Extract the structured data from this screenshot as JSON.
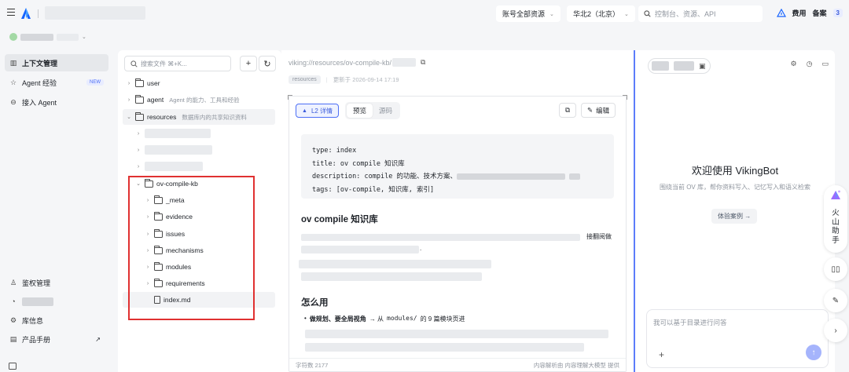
{
  "topbar": {
    "account_scope": "账号全部资源",
    "region": "华北2（北京）",
    "search_placeholder": "控制台、资源、API",
    "fees": "费用",
    "filing": "备案",
    "notification_count": "3"
  },
  "sidebar": {
    "nav": [
      {
        "label": "上下文管理",
        "icon": "book-icon"
      },
      {
        "label": "Agent 经验",
        "icon": "star-icon",
        "badge": "NEW"
      },
      {
        "label": "接入 Agent",
        "icon": "link-icon"
      }
    ],
    "bottom": [
      {
        "label": "鉴权管理",
        "icon": "user-icon"
      },
      {
        "label": "",
        "icon": "chart-icon"
      },
      {
        "label": "库信息",
        "icon": "gear-icon"
      },
      {
        "label": "产品手册",
        "icon": "doc-icon",
        "arrow": "↗"
      }
    ]
  },
  "tree": {
    "search_placeholder": "搜索文件 ⌘+K...",
    "add_label": "+",
    "refresh_label": "↻",
    "items": [
      {
        "name": "user",
        "desc": ""
      },
      {
        "name": "agent",
        "desc": "Agent 的能力、工具和经验"
      },
      {
        "name": "resources",
        "desc": "数据库内的共享知识资料"
      }
    ],
    "kb": {
      "name": "ov-compile-kb",
      "children": [
        "_meta",
        "evidence",
        "issues",
        "mechanisms",
        "modules",
        "requirements"
      ],
      "file": "index.md"
    }
  },
  "doc": {
    "path": "viking://resources/ov-compile-kb/",
    "tag": "resources",
    "updated": "更新于 2026-09-14 17:19",
    "l2_label": "L2 详情",
    "tabs": {
      "preview": "预览",
      "source": "源码"
    },
    "edit_label": "编辑",
    "code_lines": {
      "type": "type: index",
      "title": "title: ov compile 知识库",
      "description": "description: compile 的功能、技术方案、",
      "tags": "tags: [ov-compile, 知识库, 索引]"
    },
    "h1": "ov compile 知识库",
    "para_fragment": "接翻阅做",
    "para_end": ".",
    "h2": "怎么用",
    "bullet_bold": "做规划、要全局视角",
    "bullet_rest": "→ 从",
    "bullet_code": "modules/",
    "bullet_tail": "的 9 篇模块页进",
    "char_count": "字符数 2177",
    "footer_note": "内容解析由 内容理解大模型 提供"
  },
  "chat": {
    "welcome": "欢迎使用 VikingBot",
    "subtitle": "围绕当前 OV 库，帮你资料写入、记忆写入和语义检索",
    "try_label": "体验案例 →",
    "input_placeholder": "我可以基于目录进行问答"
  },
  "floating": {
    "assistant": "火山助手"
  },
  "colors": {
    "accent": "#4c6ef5",
    "highlight_box": "#e03131"
  }
}
